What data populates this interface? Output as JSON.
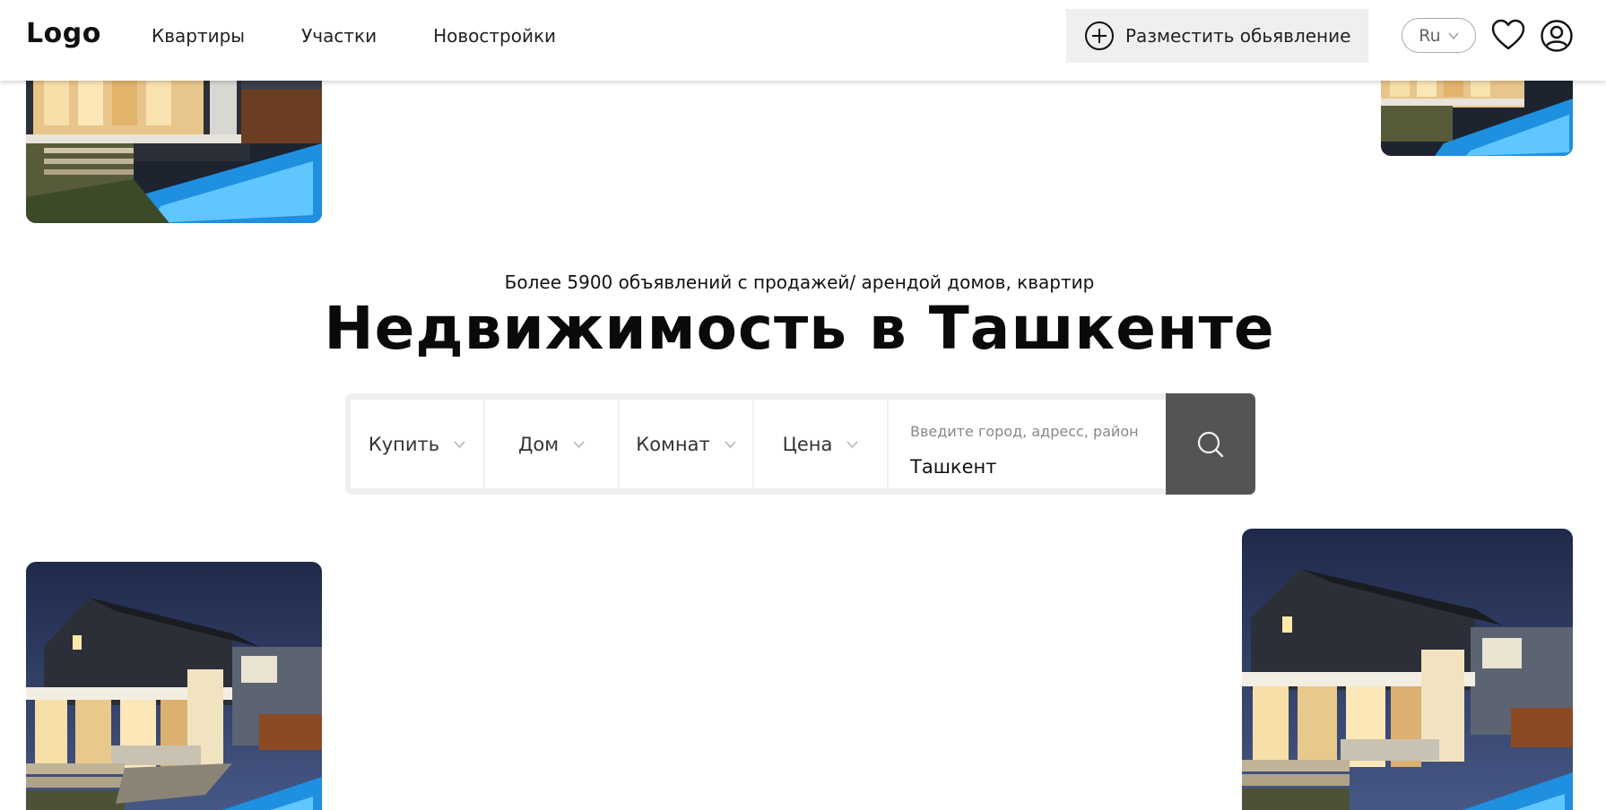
{
  "header": {
    "logo": "Logo",
    "nav": [
      "Квартиры",
      "Участки",
      "Новостройки"
    ],
    "post_button": "Разместить обьявление",
    "language": "Ru"
  },
  "hero": {
    "subtitle": "Более 5900 объявлений с продажей/ арендой домов, квартир",
    "title": "Недвижимость в Ташкенте"
  },
  "search": {
    "deal_type": "Купить",
    "property_type": "Дом",
    "rooms": "Комнат",
    "price": "Цена",
    "address_placeholder": "Введите город, адресс, район",
    "address_value": "Ташкент"
  },
  "icons": {
    "post": "plus-circle-icon",
    "language": "chevron-down-icon",
    "favorites": "heart-icon",
    "account": "user-icon",
    "search": "search-icon"
  },
  "colors": {
    "search_button": "#545454",
    "post_button_bg": "#efefef",
    "text": "#111111"
  }
}
